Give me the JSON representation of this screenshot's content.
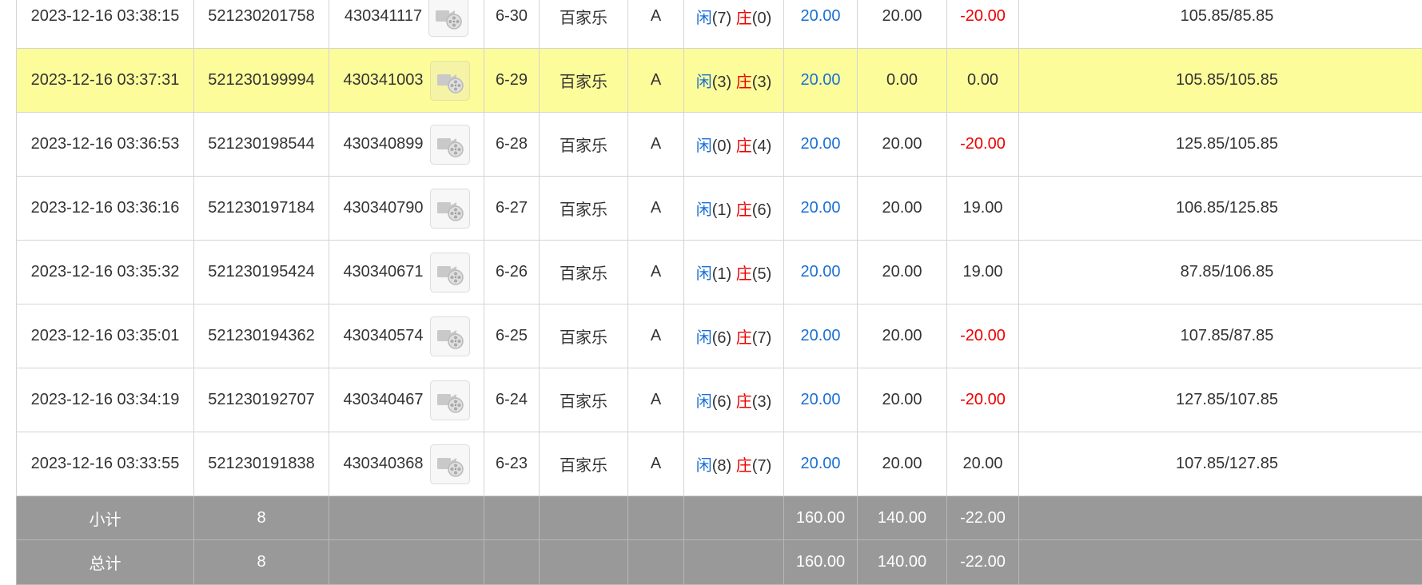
{
  "rows": [
    {
      "time": "2023-12-16 03:38:15",
      "order_no": "521230201758",
      "game_no": "430341117",
      "round": "6-30",
      "game": "百家乐",
      "table": "A",
      "player_label": "闲",
      "player_pts": "(7)",
      "banker_label": "庄",
      "banker_pts": "(0)",
      "bet": "20.00",
      "valid": "20.00",
      "winloss": "-20.00",
      "balance": "105.85/85.85",
      "highlight": false
    },
    {
      "time": "2023-12-16 03:37:31",
      "order_no": "521230199994",
      "game_no": "430341003",
      "round": "6-29",
      "game": "百家乐",
      "table": "A",
      "player_label": "闲",
      "player_pts": "(3)",
      "banker_label": "庄",
      "banker_pts": "(3)",
      "bet": "20.00",
      "valid": "0.00",
      "winloss": "0.00",
      "balance": "105.85/105.85",
      "highlight": true
    },
    {
      "time": "2023-12-16 03:36:53",
      "order_no": "521230198544",
      "game_no": "430340899",
      "round": "6-28",
      "game": "百家乐",
      "table": "A",
      "player_label": "闲",
      "player_pts": "(0)",
      "banker_label": "庄",
      "banker_pts": "(4)",
      "bet": "20.00",
      "valid": "20.00",
      "winloss": "-20.00",
      "balance": "125.85/105.85",
      "highlight": false
    },
    {
      "time": "2023-12-16 03:36:16",
      "order_no": "521230197184",
      "game_no": "430340790",
      "round": "6-27",
      "game": "百家乐",
      "table": "A",
      "player_label": "闲",
      "player_pts": "(1)",
      "banker_label": "庄",
      "banker_pts": "(6)",
      "bet": "20.00",
      "valid": "20.00",
      "winloss": "19.00",
      "balance": "106.85/125.85",
      "highlight": false
    },
    {
      "time": "2023-12-16 03:35:32",
      "order_no": "521230195424",
      "game_no": "430340671",
      "round": "6-26",
      "game": "百家乐",
      "table": "A",
      "player_label": "闲",
      "player_pts": "(1)",
      "banker_label": "庄",
      "banker_pts": "(5)",
      "bet": "20.00",
      "valid": "20.00",
      "winloss": "19.00",
      "balance": "87.85/106.85",
      "highlight": false
    },
    {
      "time": "2023-12-16 03:35:01",
      "order_no": "521230194362",
      "game_no": "430340574",
      "round": "6-25",
      "game": "百家乐",
      "table": "A",
      "player_label": "闲",
      "player_pts": "(6)",
      "banker_label": "庄",
      "banker_pts": "(7)",
      "bet": "20.00",
      "valid": "20.00",
      "winloss": "-20.00",
      "balance": "107.85/87.85",
      "highlight": false
    },
    {
      "time": "2023-12-16 03:34:19",
      "order_no": "521230192707",
      "game_no": "430340467",
      "round": "6-24",
      "game": "百家乐",
      "table": "A",
      "player_label": "闲",
      "player_pts": "(6)",
      "banker_label": "庄",
      "banker_pts": "(3)",
      "bet": "20.00",
      "valid": "20.00",
      "winloss": "-20.00",
      "balance": "127.85/107.85",
      "highlight": false
    },
    {
      "time": "2023-12-16 03:33:55",
      "order_no": "521230191838",
      "game_no": "430340368",
      "round": "6-23",
      "game": "百家乐",
      "table": "A",
      "player_label": "闲",
      "player_pts": "(8)",
      "banker_label": "庄",
      "banker_pts": "(7)",
      "bet": "20.00",
      "valid": "20.00",
      "winloss": "20.00",
      "balance": "107.85/127.85",
      "highlight": false
    }
  ],
  "subtotal": {
    "label": "小计",
    "count": "8",
    "bet": "160.00",
    "valid": "140.00",
    "winloss": "-22.00"
  },
  "total": {
    "label": "总计",
    "count": "8",
    "bet": "160.00",
    "valid": "140.00",
    "winloss": "-22.00"
  },
  "icons": {
    "replay": "video-replay-icon"
  },
  "colors": {
    "player": "#1a6fd6",
    "banker": "#ee0000",
    "loss": "#ee0000",
    "highlight": "#fdfc9a",
    "summary_bg": "#999999"
  }
}
